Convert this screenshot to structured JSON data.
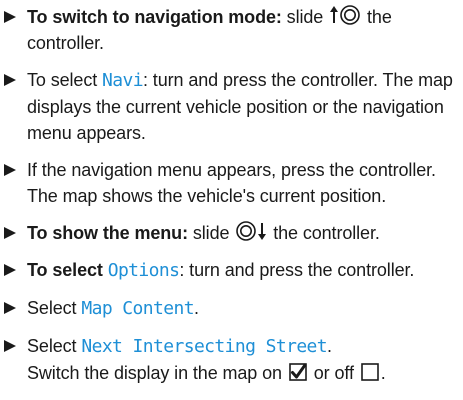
{
  "steps": [
    {
      "lead_bold": "To switch to navigation mode:",
      "text_a": " slide ",
      "icon": "controller-slide-up-icon",
      "text_b": " the controller."
    },
    {
      "text_a": "To select ",
      "ui_term": "Navi",
      "text_b": ": turn and press the controller. The map displays the current vehicle position or the navigation menu appears."
    },
    {
      "text_a": "If the navigation menu appears, press the controller.",
      "result": "The map shows the vehicle's current position."
    },
    {
      "lead_bold": "To show the menu:",
      "text_a": " slide ",
      "icon": "controller-slide-down-icon",
      "text_b": " the controller."
    },
    {
      "lead_bold": "To select ",
      "ui_term": "Options",
      "text_b": ": turn and press the controller."
    },
    {
      "text_a": "Select ",
      "ui_term": "Map Content",
      "text_b": "."
    },
    {
      "text_a": "Select ",
      "ui_term": "Next Intersecting Street",
      "text_b": ".",
      "result_a": "Switch the display in the map on ",
      "icon_on": "checkbox-checked-icon",
      "result_b": " or off ",
      "icon_off": "checkbox-unchecked-icon",
      "result_c": "."
    }
  ]
}
